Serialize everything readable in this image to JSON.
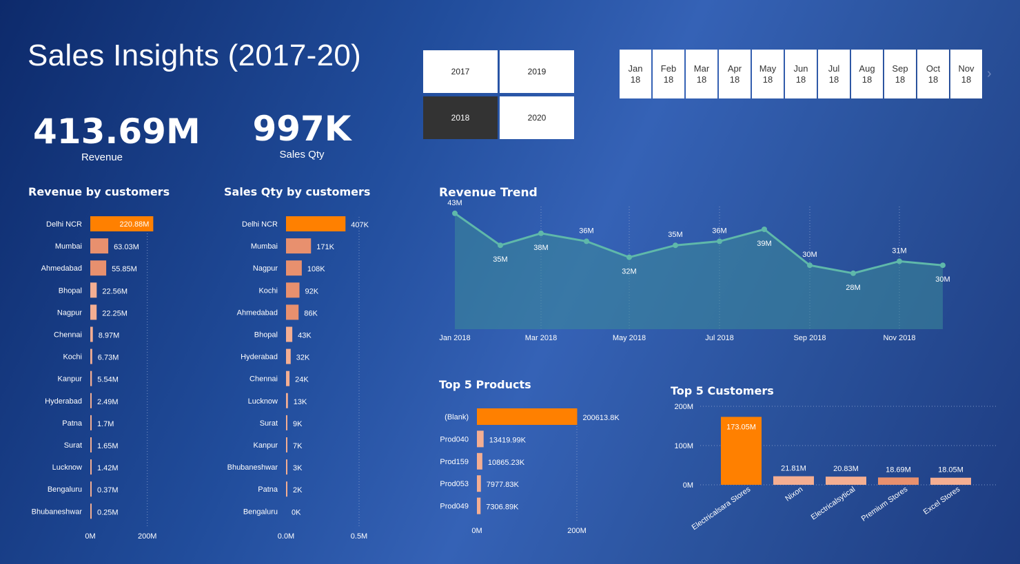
{
  "title": "Sales Insights (2017-20)",
  "kpis": {
    "revenue_value": "413.69M",
    "revenue_label": "Revenue",
    "qty_value": "997K",
    "qty_label": "Sales Qty"
  },
  "year_slicer": {
    "years": [
      "2017",
      "2019",
      "2018",
      "2020"
    ],
    "selected": "2018"
  },
  "month_slicer": {
    "months": [
      {
        "top": "Jan",
        "bottom": "18"
      },
      {
        "top": "Feb",
        "bottom": "18"
      },
      {
        "top": "Mar",
        "bottom": "18"
      },
      {
        "top": "Apr",
        "bottom": "18"
      },
      {
        "top": "May",
        "bottom": "18"
      },
      {
        "top": "Jun",
        "bottom": "18"
      },
      {
        "top": "Jul",
        "bottom": "18"
      },
      {
        "top": "Aug",
        "bottom": "18"
      },
      {
        "top": "Sep",
        "bottom": "18"
      },
      {
        "top": "Oct",
        "bottom": "18"
      },
      {
        "top": "Nov",
        "bottom": "18"
      }
    ],
    "next_icon": "chevron-right-icon"
  },
  "colors": {
    "highlight": "#ff8000",
    "bar_light": "#f4ae92",
    "bar_mid": "#e8906e",
    "line": "#5fb8aa",
    "area": "#3d8a99"
  },
  "chart_data": [
    {
      "id": "revenue_by_customers",
      "type": "bar",
      "orientation": "horizontal",
      "title": "Revenue by customers",
      "categories": [
        "Delhi NCR",
        "Mumbai",
        "Ahmedabad",
        "Bhopal",
        "Nagpur",
        "Chennai",
        "Kochi",
        "Kanpur",
        "Hyderabad",
        "Patna",
        "Surat",
        "Lucknow",
        "Bengaluru",
        "Bhubaneshwar"
      ],
      "values": [
        220.88,
        63.03,
        55.85,
        22.56,
        22.25,
        8.97,
        6.73,
        5.54,
        2.49,
        1.7,
        1.65,
        1.42,
        0.37,
        0.25
      ],
      "labels": [
        "220.88M",
        "63.03M",
        "55.85M",
        "22.56M",
        "22.25M",
        "8.97M",
        "6.73M",
        "5.54M",
        "2.49M",
        "1.7M",
        "1.65M",
        "1.42M",
        "0.37M",
        "0.25M"
      ],
      "xlim": [
        0,
        220
      ],
      "ticks": [
        {
          "v": 0,
          "label": "0M"
        },
        {
          "v": 200,
          "label": "200M"
        }
      ]
    },
    {
      "id": "sales_qty_by_customers",
      "type": "bar",
      "orientation": "horizontal",
      "title": "Sales Qty by customers",
      "categories": [
        "Delhi NCR",
        "Mumbai",
        "Nagpur",
        "Kochi",
        "Ahmedabad",
        "Bhopal",
        "Hyderabad",
        "Chennai",
        "Lucknow",
        "Surat",
        "Kanpur",
        "Bhubaneshwar",
        "Patna",
        "Bengaluru"
      ],
      "values": [
        407,
        171,
        108,
        92,
        86,
        43,
        32,
        24,
        13,
        9,
        7,
        3,
        2,
        0
      ],
      "labels": [
        "407K",
        "171K",
        "108K",
        "92K",
        "86K",
        "43K",
        "32K",
        "24K",
        "13K",
        "9K",
        "7K",
        "3K",
        "2K",
        "0K"
      ],
      "xlim": [
        0,
        500
      ],
      "ticks": [
        {
          "v": 0,
          "label": "0.0M"
        },
        {
          "v": 500,
          "label": "0.5M"
        }
      ]
    },
    {
      "id": "revenue_trend",
      "type": "area",
      "title": "Revenue Trend",
      "x": [
        "Jan 2018",
        "Feb 2018",
        "Mar 2018",
        "Apr 2018",
        "May 2018",
        "Jun 2018",
        "Jul 2018",
        "Aug 2018",
        "Sep 2018",
        "Oct 2018",
        "Nov 2018",
        "Dec 2018"
      ],
      "values": [
        43,
        35,
        38,
        36,
        32,
        35,
        36,
        39,
        30,
        28,
        31,
        30
      ],
      "labels": [
        "43M",
        "35M",
        "38M",
        "36M",
        "32M",
        "35M",
        "36M",
        "39M",
        "30M",
        "28M",
        "31M",
        "30M"
      ],
      "x_tick_labels": [
        "Jan 2018",
        "Mar 2018",
        "May 2018",
        "Jul 2018",
        "Sep 2018",
        "Nov 2018"
      ],
      "grid": "vertical dotted"
    },
    {
      "id": "top5_products",
      "type": "bar",
      "orientation": "horizontal",
      "title": "Top 5 Products",
      "categories": [
        "(Blank)",
        "Prod040",
        "Prod159",
        "Prod053",
        "Prod049"
      ],
      "values": [
        200613.8,
        13419.99,
        10865.23,
        7977.83,
        7306.89
      ],
      "labels": [
        "200613.8K",
        "13419.99K",
        "10865.23K",
        "7977.83K",
        "7306.89K"
      ],
      "xlim": [
        0,
        200000
      ],
      "ticks": [
        {
          "v": 0,
          "label": "0M"
        },
        {
          "v": 200000,
          "label": "200M"
        }
      ]
    },
    {
      "id": "top5_customers",
      "type": "bar",
      "orientation": "vertical",
      "title": "Top 5 Customers",
      "categories": [
        "Electricalsara Stores",
        "Nixon",
        "Electricalsytical",
        "Premium Stores",
        "Excel Stores"
      ],
      "values": [
        173.05,
        21.81,
        20.83,
        18.69,
        18.05
      ],
      "labels": [
        "173.05M",
        "21.81M",
        "20.83M",
        "18.69M",
        "18.05M"
      ],
      "ylim": [
        0,
        200
      ],
      "ticks": [
        {
          "v": 0,
          "label": "0M"
        },
        {
          "v": 100,
          "label": "100M"
        },
        {
          "v": 200,
          "label": "200M"
        }
      ]
    }
  ]
}
